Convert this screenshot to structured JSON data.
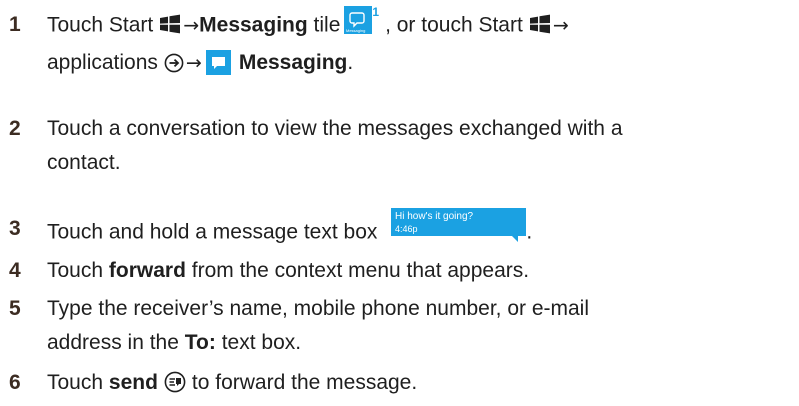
{
  "steps": [
    {
      "number": "1",
      "line1_prefix": "Touch Start",
      "arrow1": "→",
      "messaging_bold": "Messaging",
      "tile_word": "tile",
      "tile_badge": "1",
      "tile_label": "Messaging",
      "line1_mid": ", or touch Start",
      "arrow2": "→",
      "line2_prefix": "applications",
      "arrow3": "→",
      "messaging_bold2": "Messaging",
      "period": "."
    },
    {
      "number": "2",
      "line1": "Touch a conversation to view the messages exchanged with a",
      "line2": "contact."
    },
    {
      "number": "3",
      "text": "Touch and hold a message text box",
      "bubble_text": "Hi how's it going?",
      "bubble_time": "4:46p",
      "period": "."
    },
    {
      "number": "4",
      "prefix": "Touch",
      "bold": "forward",
      "suffix": "from the context menu that appears."
    },
    {
      "number": "5",
      "line1": "Type the receiver’s name, mobile phone number, or e-mail",
      "line2_prefix": "address in the",
      "bold": "To:",
      "line2_suffix": "text box."
    },
    {
      "number": "6",
      "prefix": "Touch",
      "bold": "send",
      "suffix": "to forward the message."
    }
  ],
  "colors": {
    "accent": "#1ba1e2",
    "text": "#1f1f1f",
    "step_number": "#3c2c22"
  },
  "icons": {
    "start": "windows-logo-icon",
    "applications": "arrow-circle-right-icon",
    "messaging": "messaging-icon",
    "send": "send-icon"
  }
}
